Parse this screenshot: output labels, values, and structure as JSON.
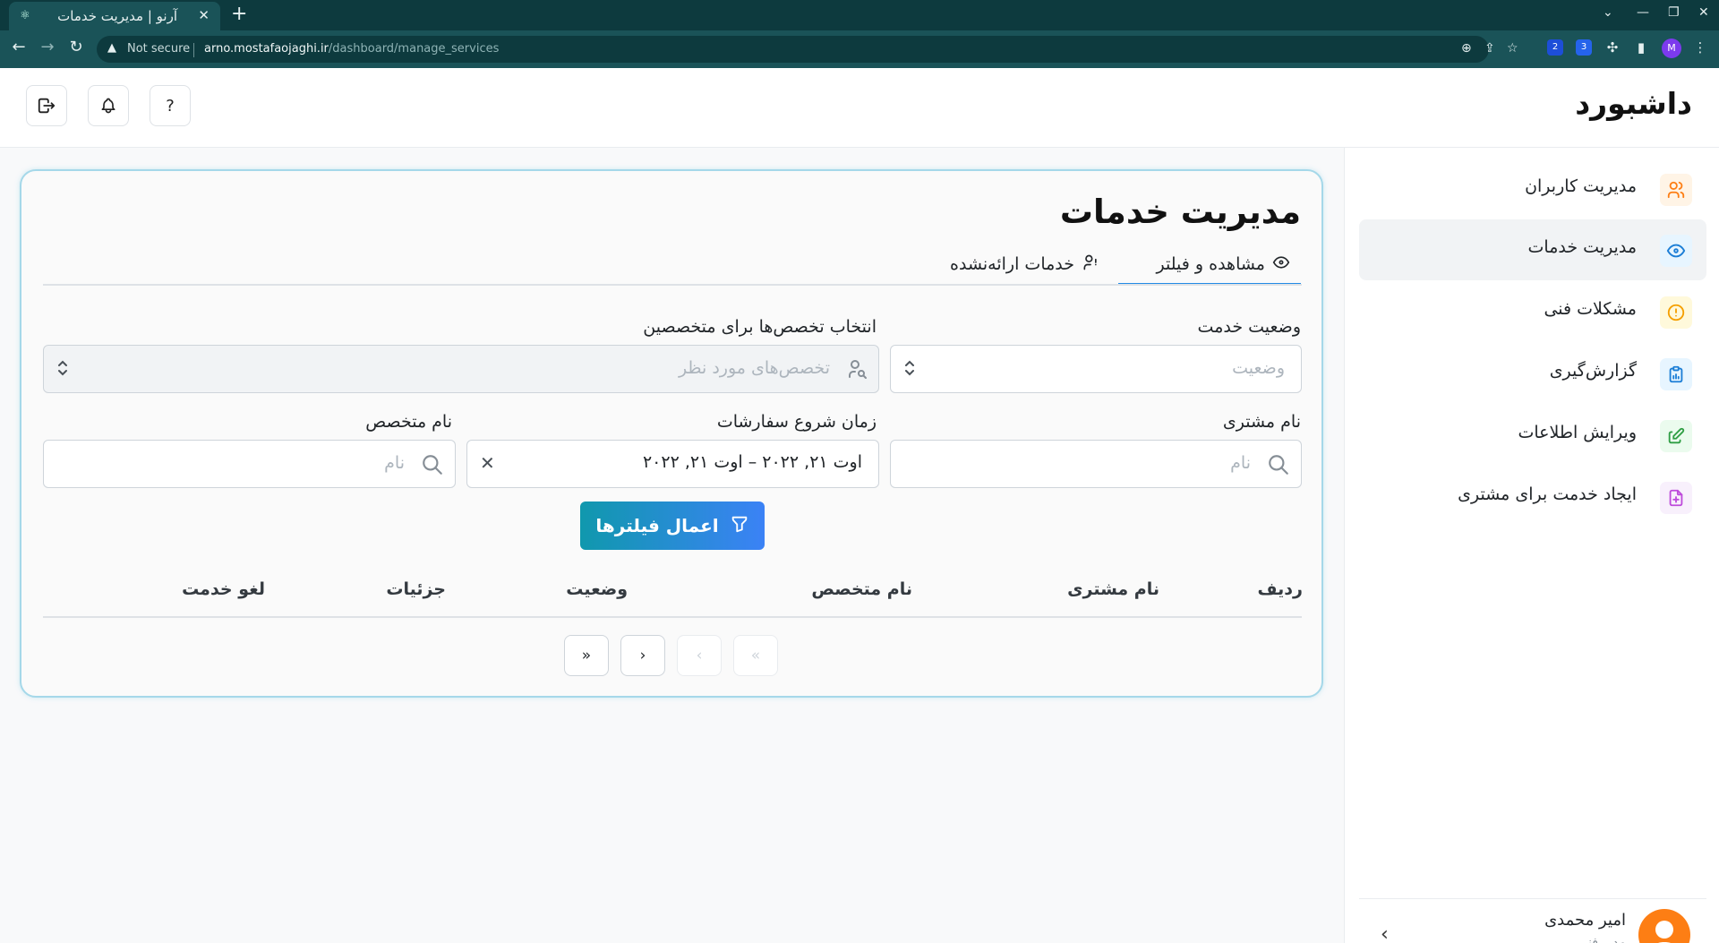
{
  "browser": {
    "tab_title": "آرنو | مدیریت خدمات",
    "not_secure": "Not secure",
    "url_host": "arno.mostafaojaghi.ir",
    "url_path": "/dashboard/manage_services",
    "profile_initial": "M",
    "ext_badge_1": "2",
    "ext_badge_2": "3"
  },
  "header": {
    "logo": "داشبورد",
    "help_label": "?"
  },
  "sidebar": {
    "items": [
      {
        "label": "مدیریت کاربران",
        "icon": "users-icon",
        "color": "#fd7e14",
        "bg": "#fff4e6"
      },
      {
        "label": "مدیریت خدمات",
        "icon": "eye-icon",
        "color": "#1c7ed6",
        "bg": "#e7f5ff"
      },
      {
        "label": "مشکلات فنی",
        "icon": "alert-circle-icon",
        "color": "#f59f00",
        "bg": "#fff9db"
      },
      {
        "label": "گزارش‌گیری",
        "icon": "clipboard-icon",
        "color": "#1c7ed6",
        "bg": "#e7f5ff"
      },
      {
        "label": "ویرایش اطلاعات",
        "icon": "pencil-icon",
        "color": "#2f9e44",
        "bg": "#ebfbee"
      },
      {
        "label": "ایجاد خدمت برای مشتری",
        "icon": "file-plus-icon",
        "color": "#be4bdb",
        "bg": "#f8f0fc"
      }
    ],
    "active_index": 1,
    "user": {
      "name": "امیر محمدی",
      "role": "مدیر فنی"
    }
  },
  "main": {
    "title": "مدیریت خدمات",
    "tabs": [
      {
        "label": "مشاهده و فیلتر",
        "icon": "eye-icon",
        "active": true
      },
      {
        "label": "خدمات ارائه‌نشده",
        "icon": "user-off-icon",
        "active": false
      }
    ],
    "filters": {
      "service_status": {
        "label": "وضعیت خدمت",
        "placeholder": "وضعیت"
      },
      "specialties": {
        "label": "انتخاب تخصص‌ها برای متخصصین",
        "placeholder": "تخصص‌های مورد نظر"
      },
      "customer_name": {
        "label": "نام مشتری",
        "placeholder": "نام"
      },
      "order_start": {
        "label": "زمان شروع سفارشات",
        "value": "اوت ۲۱, ۲۰۲۲ – اوت ۲۱, ۲۰۲۲"
      },
      "expert_name": {
        "label": "نام متخصص",
        "placeholder": "نام"
      }
    },
    "apply_button": "اعمال فیلترها",
    "table": {
      "columns": [
        "ردیف",
        "نام مشتری",
        "نام متخصص",
        "وضعیت",
        "جزئیات",
        "لغو خدمت"
      ],
      "rows": []
    },
    "pagination": {
      "first": "«",
      "prev": "‹",
      "next": "›",
      "last": "»"
    }
  },
  "colors": {
    "accent": "#228be6",
    "button_gradient_start": "#1098ad",
    "button_gradient_end": "#3b82f6",
    "card_border": "#a5d8e9"
  }
}
